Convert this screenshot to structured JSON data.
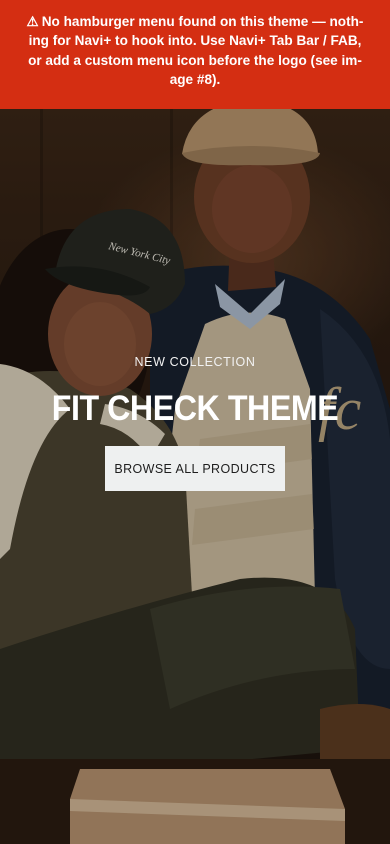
{
  "banner": {
    "icon": "warning-icon",
    "text": "No hamburger menu found on this theme — nothing for Navi+ to hook into. Use Navi+ Tab Bar / FAB, or add a custom menu icon before the logo (see image #8).",
    "line_1": "No hamburger menu found on this theme — noth-",
    "line_2": "ing for Navi+ to hook into. Use Navi+ Tab Bar / FAB,",
    "line_3": "or add a custom menu icon before the logo (see im-",
    "line_4": "age #8).",
    "background_color": "#d42e12",
    "text_color": "#ffffff"
  },
  "hero": {
    "eyebrow": "NEW COLLECTION",
    "title": "FIT CHECK THEME",
    "button_label": "BROWSE ALL PRODUCTS",
    "cap_text": "New York City",
    "jacket_monogram": "fc"
  }
}
